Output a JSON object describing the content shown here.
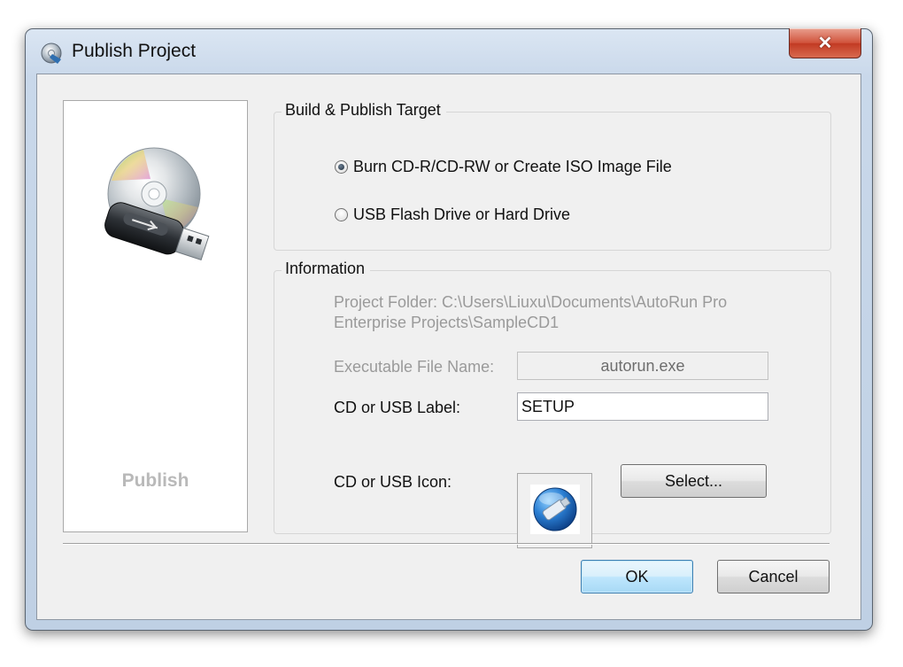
{
  "window": {
    "title": "Publish Project",
    "close_symbol": "✕"
  },
  "left_panel": {
    "label": "Publish",
    "image_icon": "cd-usb-icon"
  },
  "build_group": {
    "title": "Build & Publish Target",
    "options": [
      {
        "label": "Burn CD-R/CD-RW or Create ISO Image File",
        "checked": true
      },
      {
        "label": "USB Flash Drive or Hard Drive",
        "checked": false
      }
    ]
  },
  "info_group": {
    "title": "Information",
    "project_folder_line1": "Project Folder: C:\\Users\\Liuxu\\Documents\\AutoRun Pro",
    "project_folder_line2": "Enterprise Projects\\SampleCD1",
    "exe_label": "Executable File Name:",
    "exe_value": "autorun.exe",
    "cd_label_label": "CD or USB Label:",
    "cd_label_value": "SETUP",
    "cd_icon_label": "CD or USB Icon:",
    "select_button": "Select..."
  },
  "buttons": {
    "ok": "OK",
    "cancel": "Cancel"
  }
}
